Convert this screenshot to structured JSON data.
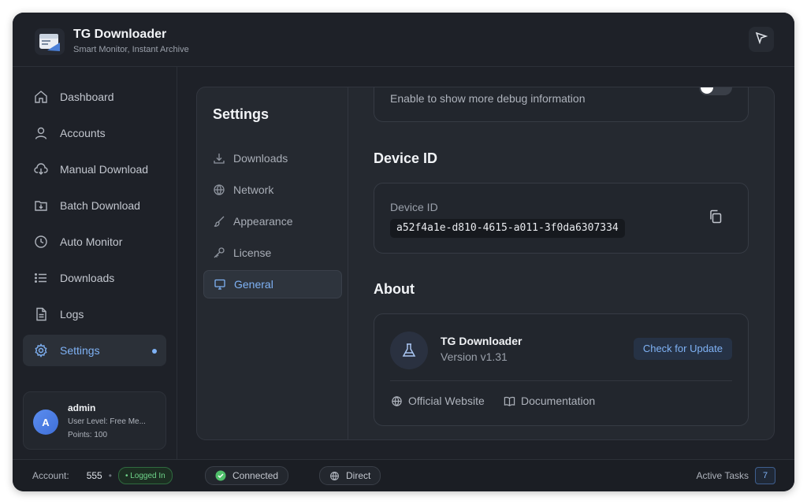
{
  "colors": {
    "accent": "#7fb2f5",
    "success": "#4fbf6a",
    "window_bg": "#1e2128"
  },
  "app": {
    "title": "TG Downloader",
    "subtitle": "Smart Monitor, Instant Archive",
    "logo_icon": "app-logo-icon",
    "header_action_icon": "cursor-pointer-icon"
  },
  "sidebar": {
    "items": [
      {
        "label": "Dashboard",
        "icon": "home-icon",
        "active": false
      },
      {
        "label": "Accounts",
        "icon": "user-icon",
        "active": false
      },
      {
        "label": "Manual Download",
        "icon": "cloud-download-icon",
        "active": false
      },
      {
        "label": "Batch Download",
        "icon": "folder-download-icon",
        "active": false
      },
      {
        "label": "Auto Monitor",
        "icon": "clock-icon",
        "active": false
      },
      {
        "label": "Downloads",
        "icon": "list-icon",
        "active": false
      },
      {
        "label": "Logs",
        "icon": "file-text-icon",
        "active": false
      },
      {
        "label": "Settings",
        "icon": "gear-icon",
        "active": true
      }
    ],
    "user": {
      "avatar_letter": "A",
      "name": "admin",
      "level": "User Level: Free Me...",
      "points": "Points: 100"
    }
  },
  "settings": {
    "title": "Settings",
    "nav": [
      {
        "label": "Downloads",
        "icon": "download-icon",
        "active": false
      },
      {
        "label": "Network",
        "icon": "globe-icon",
        "active": false
      },
      {
        "label": "Appearance",
        "icon": "brush-icon",
        "active": false
      },
      {
        "label": "License",
        "icon": "key-icon",
        "active": false
      },
      {
        "label": "General",
        "icon": "monitor-icon",
        "active": true
      }
    ],
    "debug": {
      "description": "Enable to show more debug information",
      "enabled": false
    },
    "device": {
      "section_title": "Device ID",
      "label": "Device ID",
      "value": "a52f4a1e-d810-4615-a011-3f0da6307334",
      "copy_icon": "copy-icon"
    },
    "about": {
      "section_title": "About",
      "app_name": "TG Downloader",
      "version": "Version v1.31",
      "update_button": "Check for Update",
      "links": [
        {
          "label": "Official Website",
          "icon": "globe-icon"
        },
        {
          "label": "Documentation",
          "icon": "book-icon"
        }
      ]
    }
  },
  "statusbar": {
    "account_label": "Account:",
    "account_value": "555",
    "separator": "•",
    "logged_in": "• Logged In",
    "connection": "Connected",
    "proxy": "Direct",
    "active_tasks_label": "Active Tasks",
    "active_tasks_count": "7"
  }
}
